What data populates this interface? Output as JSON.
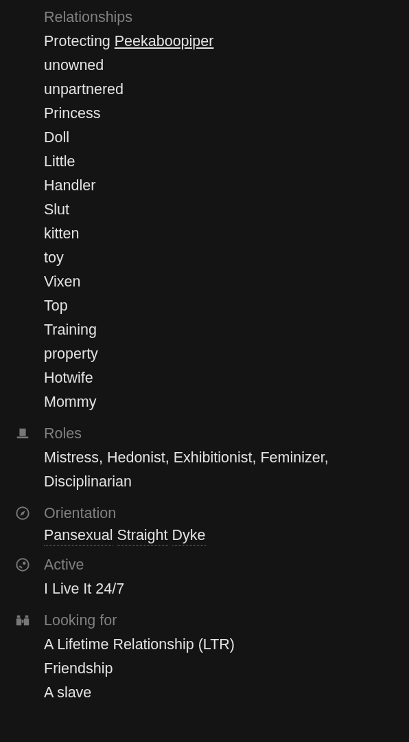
{
  "sections": [
    {
      "heading": "Relationships",
      "kind": "list",
      "items": [
        {
          "text": "Protecting",
          "link": "Peekaboopiper"
        },
        {
          "text": "unowned"
        },
        {
          "text": "unpartnered"
        },
        {
          "text": "Princess"
        },
        {
          "text": "Doll"
        },
        {
          "text": "Little"
        },
        {
          "text": "Handler"
        },
        {
          "text": "Slut"
        },
        {
          "text": "kitten"
        },
        {
          "text": "toy"
        },
        {
          "text": "Vixen"
        },
        {
          "text": "Top"
        },
        {
          "text": "Training"
        },
        {
          "text": "property"
        },
        {
          "text": "Hotwife"
        },
        {
          "text": "Mommy"
        }
      ]
    },
    {
      "heading": "Roles",
      "kind": "paragraph",
      "text": "Mistress, Hedonist, Exhibitionist, Feminizer, Disciplinarian"
    },
    {
      "heading": "Orientation",
      "kind": "terms",
      "items": [
        {
          "text": "Pansexual"
        },
        {
          "text": "Straight"
        },
        {
          "text": "Dyke"
        }
      ]
    },
    {
      "heading": "Active",
      "kind": "paragraph",
      "text": "I Live It 24/7"
    },
    {
      "heading": "Looking for",
      "kind": "list",
      "items": [
        {
          "text": "A Lifetime Relationship (LTR)"
        },
        {
          "text": "Friendship"
        },
        {
          "text": "A slave"
        }
      ]
    }
  ]
}
